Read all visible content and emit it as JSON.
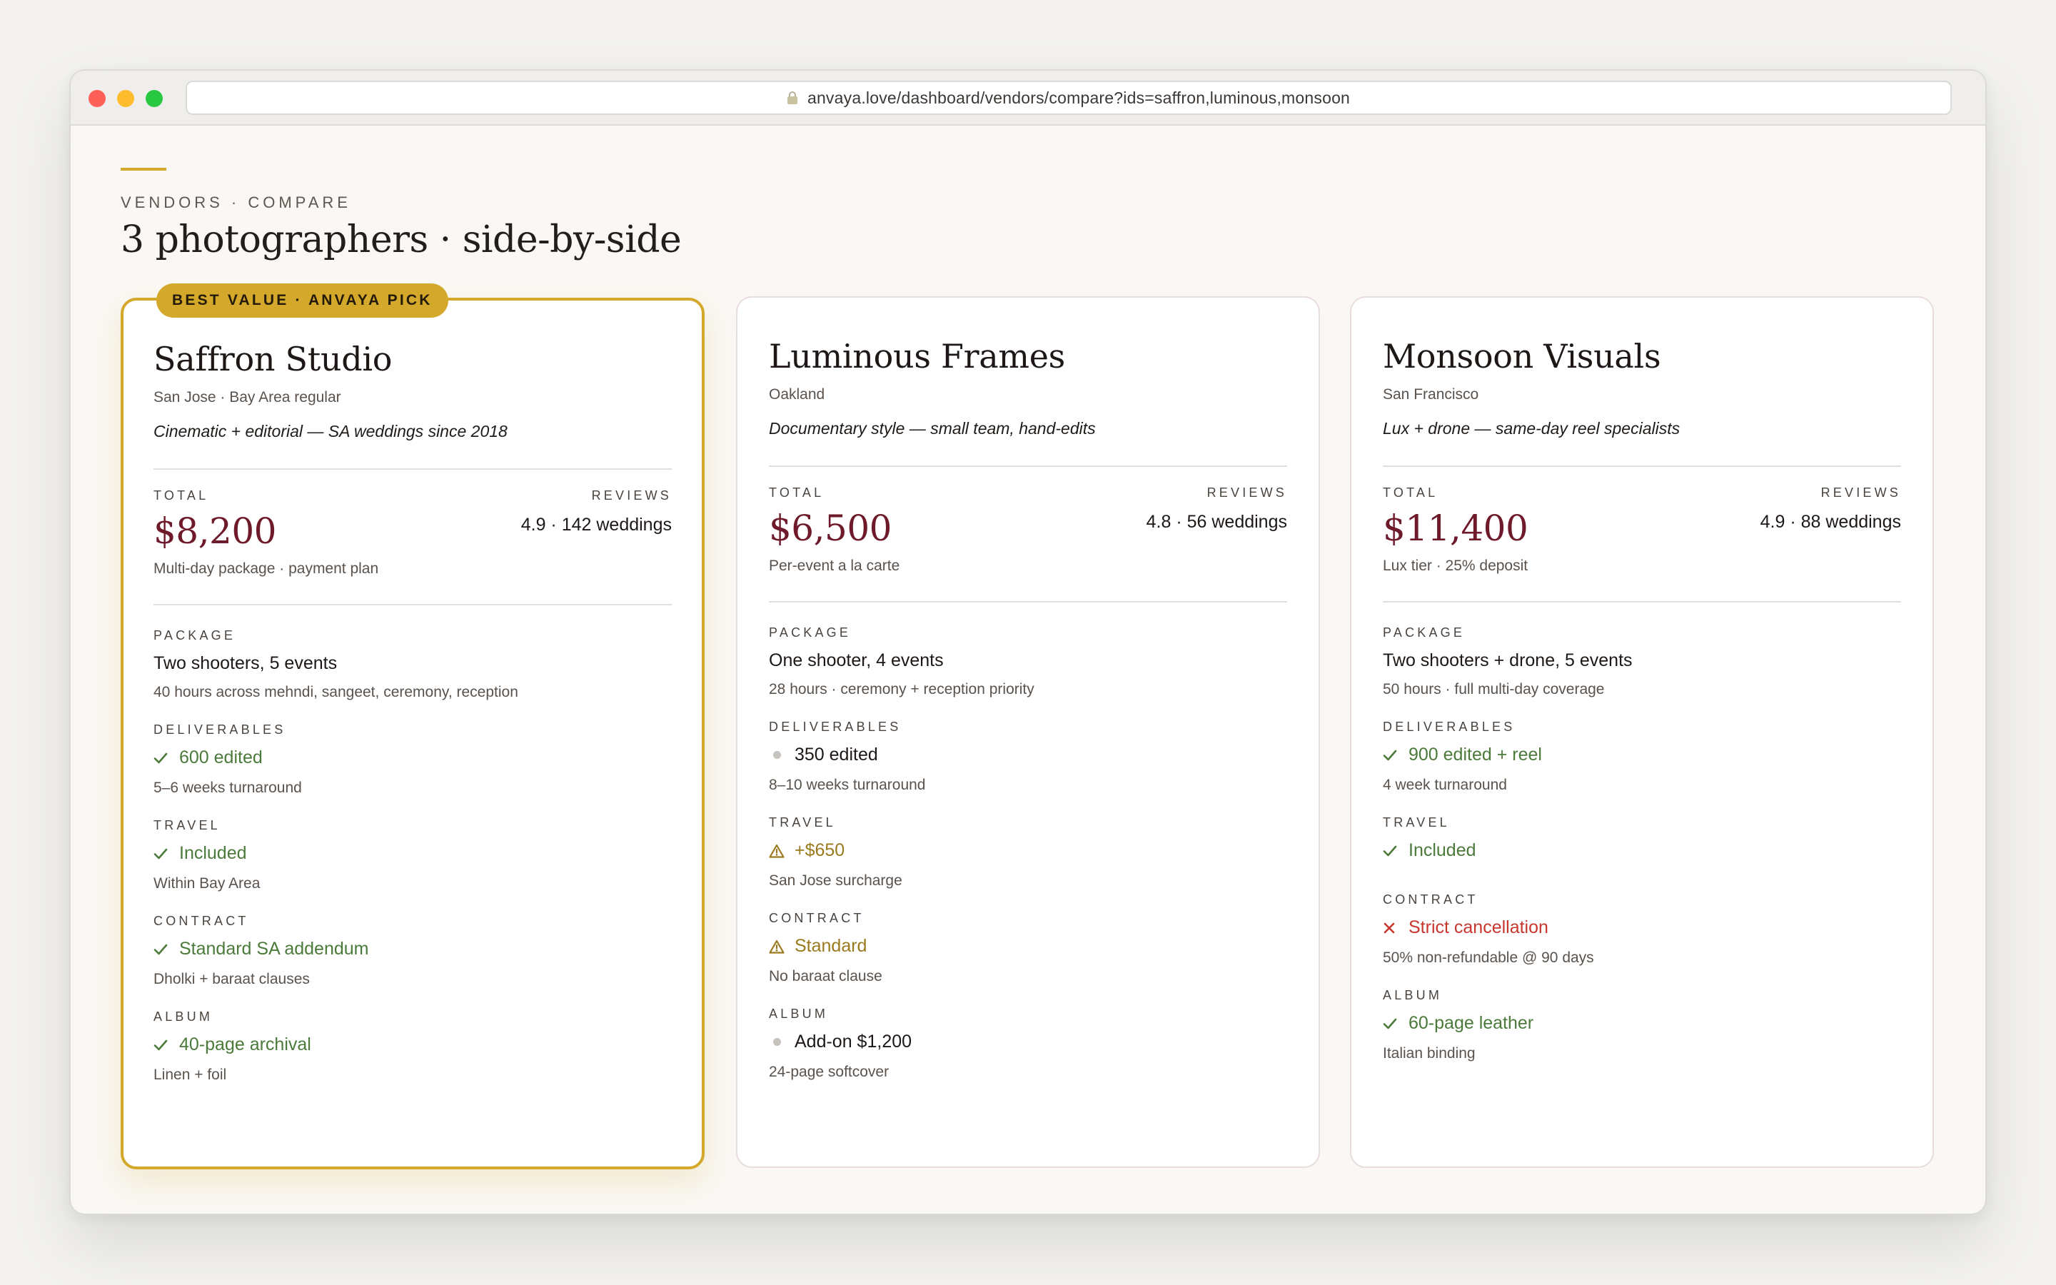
{
  "browser": {
    "url": "anvaya.love/dashboard/vendors/compare?ids=saffron,luminous,monsoon"
  },
  "header": {
    "eyebrow": "VENDORS · COMPARE",
    "title": "3 photographers · side-by-side"
  },
  "labels": {
    "total": "TOTAL",
    "reviews": "REVIEWS",
    "package": "PACKAGE",
    "deliverables": "DELIVERABLES",
    "travel": "TRAVEL",
    "contract": "CONTRACT",
    "album": "ALBUM"
  },
  "colors": {
    "accent": "#d4a82a",
    "price": "#6e1a2a",
    "good": "#4b7a3a",
    "warn": "#9a7a1e",
    "bad": "#c8362e"
  },
  "vendors": [
    {
      "badge": "BEST VALUE · ANVAYA PICK",
      "name": "Saffron Studio",
      "location": "San Jose · Bay Area regular",
      "tagline": "Cinematic + editorial — SA weddings since 2018",
      "total": "$8,200",
      "total_note": "Multi-day package · payment plan",
      "reviews": "4.9 · 142 weddings",
      "package": "Two shooters, 5 events",
      "package_note": "40 hours across mehndi, sangeet, ceremony, reception",
      "deliverables": {
        "status": "check-icon",
        "value": "600 edited",
        "note": "5–6 weeks turnaround"
      },
      "travel": {
        "status": "check-icon",
        "value": "Included",
        "note": "Within Bay Area"
      },
      "contract": {
        "status": "check-icon",
        "value": "Standard SA addendum",
        "note": "Dholki + baraat clauses"
      },
      "album": {
        "status": "check-icon",
        "value": "40-page archival",
        "note": "Linen + foil"
      }
    },
    {
      "name": "Luminous Frames",
      "location": "Oakland",
      "tagline": "Documentary style — small team, hand-edits",
      "total": "$6,500",
      "total_note": "Per-event a la carte",
      "reviews": "4.8 · 56 weddings",
      "package": "One shooter, 4 events",
      "package_note": "28 hours · ceremony + reception priority",
      "deliverables": {
        "status": "dot-icon",
        "value": "350 edited",
        "note": "8–10 weeks turnaround"
      },
      "travel": {
        "status": "warning-icon",
        "value": "+$650",
        "note": "San Jose surcharge"
      },
      "contract": {
        "status": "warning-icon",
        "value": "Standard",
        "note": "No baraat clause"
      },
      "album": {
        "status": "dot-icon",
        "value": "Add-on $1,200",
        "note": "24-page softcover"
      }
    },
    {
      "name": "Monsoon Visuals",
      "location": "San Francisco",
      "tagline": "Lux + drone — same-day reel specialists",
      "total": "$11,400",
      "total_note": "Lux tier · 25% deposit",
      "reviews": "4.9 · 88 weddings",
      "package": "Two shooters + drone, 5 events",
      "package_note": "50 hours · full multi-day coverage",
      "deliverables": {
        "status": "check-icon",
        "value": "900 edited + reel",
        "note": "4 week turnaround"
      },
      "travel": {
        "status": "check-icon",
        "value": "Included"
      },
      "contract": {
        "status": "x-icon",
        "value": "Strict cancellation",
        "note": "50% non-refundable @ 90 days"
      },
      "album": {
        "status": "check-icon",
        "value": "60-page leather",
        "note": "Italian binding"
      }
    }
  ]
}
